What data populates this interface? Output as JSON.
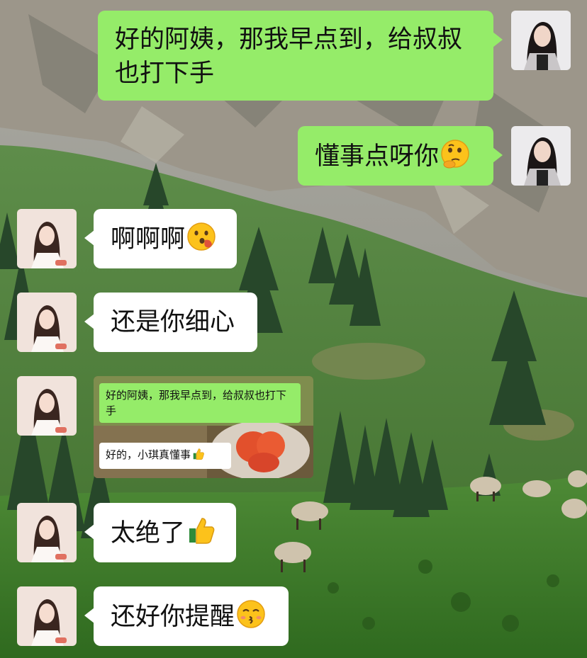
{
  "chat": {
    "messages": [
      {
        "side": "right",
        "text": "好的阿姨，那我早点到，给叔叔也打下手",
        "emoji": ""
      },
      {
        "side": "right",
        "text": "懂事点呀你",
        "emoji": "thinking-face"
      },
      {
        "side": "left",
        "text": "啊啊啊",
        "emoji": "hushed-face"
      },
      {
        "side": "left",
        "text": "还是你细心",
        "emoji": ""
      },
      {
        "side": "left",
        "type": "image",
        "image_text_1": "好的阿姨，那我早点到，给叔叔也打下手",
        "image_text_2": "好的，小琪真懂事",
        "image_emoji": "thumbs-up"
      },
      {
        "side": "left",
        "text": "太绝了",
        "emoji": "thumbs-up"
      },
      {
        "side": "left",
        "text": "还好你提醒",
        "emoji": "kissing-face"
      }
    ]
  },
  "colors": {
    "sent_bubble": "#95ec69",
    "received_bubble": "#ffffff"
  }
}
